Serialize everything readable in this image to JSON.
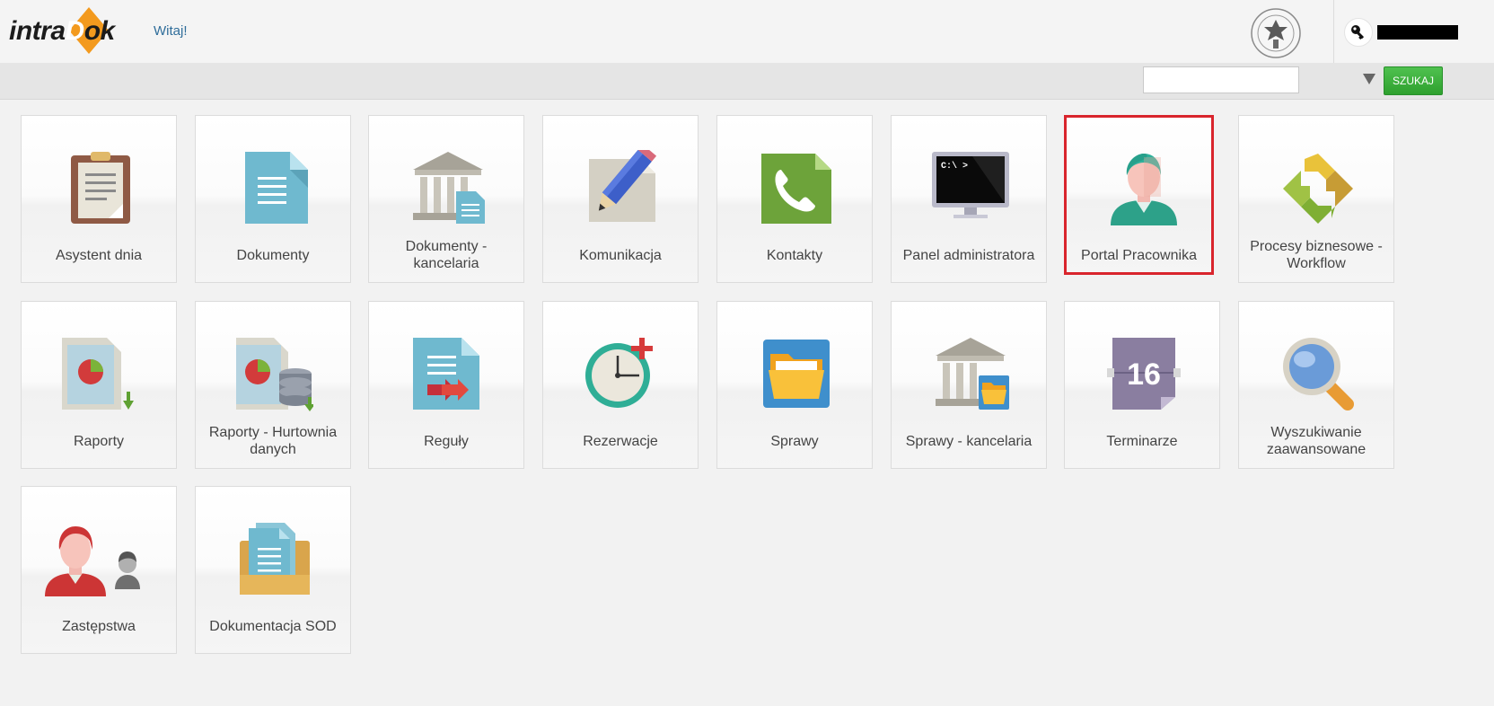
{
  "header": {
    "logo_prefix": "intra",
    "logo_letter": "D",
    "logo_suffix": "ok",
    "welcome": "Witaj!"
  },
  "search": {
    "value": "",
    "button_label": "SZUKAJ"
  },
  "tiles": [
    {
      "label": "Asystent dnia",
      "icon": "clipboard-icon"
    },
    {
      "label": "Dokumenty",
      "icon": "document-icon"
    },
    {
      "label": "Dokumenty - kancelaria",
      "icon": "bank-document-icon"
    },
    {
      "label": "Komunikacja",
      "icon": "pencil-note-icon"
    },
    {
      "label": "Kontakty",
      "icon": "phone-icon"
    },
    {
      "label": "Panel administratora",
      "icon": "monitor-console-icon"
    },
    {
      "label": "Portal Pracownika",
      "icon": "employee-icon",
      "selected": true
    },
    {
      "label": "Procesy biznesowe - Workflow",
      "icon": "workflow-arrows-icon"
    },
    {
      "label": "Raporty",
      "icon": "report-chart-icon"
    },
    {
      "label": "Raporty - Hurtownia danych",
      "icon": "report-database-icon"
    },
    {
      "label": "Reguły",
      "icon": "rules-document-icon"
    },
    {
      "label": "Rezerwacje",
      "icon": "clock-add-icon"
    },
    {
      "label": "Sprawy",
      "icon": "folder-icon"
    },
    {
      "label": "Sprawy - kancelaria",
      "icon": "bank-folder-icon"
    },
    {
      "label": "Terminarze",
      "icon": "calendar-icon",
      "icon_text": "16"
    },
    {
      "label": "Wyszukiwanie zaawansowane",
      "icon": "magnifier-icon"
    },
    {
      "label": "Zastępstwa",
      "icon": "substitute-users-icon"
    },
    {
      "label": "Dokumentacja SOD",
      "icon": "document-archive-icon"
    }
  ],
  "colors": {
    "selection": "#d9252d",
    "search_button": "#3cb03c",
    "link": "#2f6d9a",
    "logo_accent": "#f39a1e"
  }
}
